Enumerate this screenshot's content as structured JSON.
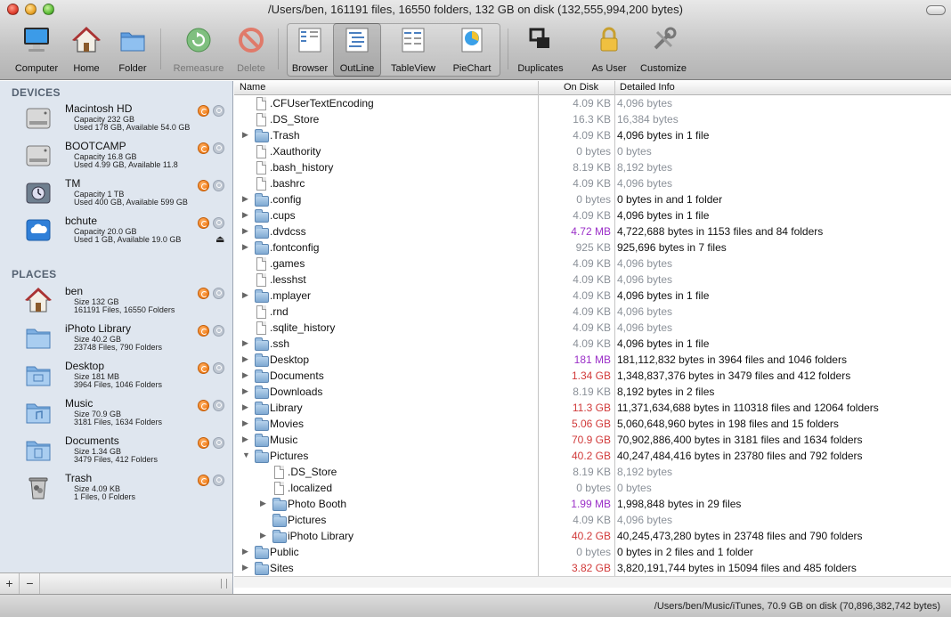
{
  "window": {
    "title": "/Users/ben, 161191 files, 16550 folders, 132 GB on disk (132,555,994,200 bytes)"
  },
  "toolbar": {
    "computer": "Computer",
    "home": "Home",
    "folder": "Folder",
    "remeasure": "Remeasure",
    "delete": "Delete",
    "browser": "Browser",
    "outline": "OutLine",
    "tableview": "TableView",
    "piechart": "PieChart",
    "duplicates": "Duplicates",
    "asuser": "As User",
    "customize": "Customize"
  },
  "sidebar": {
    "devices_header": "DEVICES",
    "places_header": "PLACES",
    "devices": [
      {
        "name": "Macintosh HD",
        "line1": "Capacity 232 GB",
        "line2": "Used 178 GB, Available 54.0 GB",
        "icon": "hard-drive-icon"
      },
      {
        "name": "BOOTCAMP",
        "line1": "Capacity 16.8 GB",
        "line2": "Used 4.99 GB, Available 11.8",
        "icon": "hard-drive-icon"
      },
      {
        "name": "TM",
        "line1": "Capacity 1 TB",
        "line2": "Used 400 GB, Available 599 GB",
        "icon": "time-machine-icon"
      },
      {
        "name": "bchute",
        "line1": "Capacity 20.0 GB",
        "line2": "Used 1 GB, Available 19.0 GB",
        "icon": "cloud-drive-icon"
      }
    ],
    "places": [
      {
        "name": "ben",
        "line1": "Size 132 GB",
        "line2": "161191 Files, 16550 Folders",
        "icon": "home-icon"
      },
      {
        "name": "iPhoto Library",
        "line1": "Size 40.2 GB",
        "line2": "23748 Files, 790 Folders",
        "icon": "folder-icon"
      },
      {
        "name": "Desktop",
        "line1": "Size 181 MB",
        "line2": "3964 Files, 1046 Folders",
        "icon": "desktop-folder-icon"
      },
      {
        "name": "Music",
        "line1": "Size 70.9 GB",
        "line2": "3181 Files, 1634 Folders",
        "icon": "music-folder-icon"
      },
      {
        "name": "Documents",
        "line1": "Size 1.34 GB",
        "line2": "3479 Files, 412 Folders",
        "icon": "documents-folder-icon"
      },
      {
        "name": "Trash",
        "line1": "Size 4.09 KB",
        "line2": "1 Files, 0 Folders",
        "icon": "trash-icon"
      }
    ],
    "add_label": "+",
    "remove_label": "−"
  },
  "table": {
    "headers": {
      "name": "Name",
      "size": "On Disk",
      "info": "Detailed Info"
    },
    "rows": [
      {
        "name": ".CFUserTextEncoding",
        "size": "4.09 KB",
        "info": "4,096 bytes",
        "kind": "file",
        "depth": 0,
        "size_color": "#8b9199",
        "gray": true
      },
      {
        "name": ".DS_Store",
        "size": "16.3 KB",
        "info": "16,384 bytes",
        "kind": "file",
        "depth": 0,
        "size_color": "#8b9199",
        "gray": true
      },
      {
        "name": ".Trash",
        "size": "4.09 KB",
        "info": "4,096 bytes in 1 file",
        "kind": "folder",
        "depth": 0,
        "size_color": "#8b9199",
        "gray": false
      },
      {
        "name": ".Xauthority",
        "size": "0 bytes",
        "info": "0 bytes",
        "kind": "file",
        "depth": 0,
        "size_color": "#8b9199",
        "gray": true
      },
      {
        "name": ".bash_history",
        "size": "8.19 KB",
        "info": "8,192 bytes",
        "kind": "file",
        "depth": 0,
        "size_color": "#8b9199",
        "gray": true
      },
      {
        "name": ".bashrc",
        "size": "4.09 KB",
        "info": "4,096 bytes",
        "kind": "file",
        "depth": 0,
        "size_color": "#8b9199",
        "gray": true
      },
      {
        "name": ".config",
        "size": "0 bytes",
        "info": "0 bytes in  and 1 folder",
        "kind": "folder",
        "depth": 0,
        "size_color": "#8b9199",
        "gray": false
      },
      {
        "name": ".cups",
        "size": "4.09 KB",
        "info": "4,096 bytes in 1 file",
        "kind": "folder",
        "depth": 0,
        "size_color": "#8b9199",
        "gray": false
      },
      {
        "name": ".dvdcss",
        "size": "4.72 MB",
        "info": "4,722,688 bytes in 1153 files and 84 folders",
        "kind": "folder",
        "depth": 0,
        "size_color": "#9b30c8",
        "gray": false
      },
      {
        "name": ".fontconfig",
        "size": "925 KB",
        "info": "925,696 bytes in 7 files",
        "kind": "folder",
        "depth": 0,
        "size_color": "#8b9199",
        "gray": false
      },
      {
        "name": ".games",
        "size": "4.09 KB",
        "info": "4,096 bytes",
        "kind": "file",
        "depth": 0,
        "size_color": "#8b9199",
        "gray": true
      },
      {
        "name": ".lesshst",
        "size": "4.09 KB",
        "info": "4,096 bytes",
        "kind": "file",
        "depth": 0,
        "size_color": "#8b9199",
        "gray": true
      },
      {
        "name": ".mplayer",
        "size": "4.09 KB",
        "info": "4,096 bytes in 1 file",
        "kind": "folder",
        "depth": 0,
        "size_color": "#8b9199",
        "gray": false
      },
      {
        "name": ".rnd",
        "size": "4.09 KB",
        "info": "4,096 bytes",
        "kind": "file",
        "depth": 0,
        "size_color": "#8b9199",
        "gray": true
      },
      {
        "name": ".sqlite_history",
        "size": "4.09 KB",
        "info": "4,096 bytes",
        "kind": "file",
        "depth": 0,
        "size_color": "#8b9199",
        "gray": true
      },
      {
        "name": ".ssh",
        "size": "4.09 KB",
        "info": "4,096 bytes in 1 file",
        "kind": "folder",
        "depth": 0,
        "size_color": "#8b9199",
        "gray": false
      },
      {
        "name": "Desktop",
        "size": "181 MB",
        "info": "181,112,832 bytes in 3964 files and 1046 folders",
        "kind": "folder",
        "depth": 0,
        "size_color": "#9b30c8",
        "gray": false
      },
      {
        "name": "Documents",
        "size": "1.34 GB",
        "info": "1,348,837,376 bytes in 3479 files and 412 folders",
        "kind": "folder",
        "depth": 0,
        "size_color": "#d13a3a",
        "gray": false
      },
      {
        "name": "Downloads",
        "size": "8.19 KB",
        "info": "8,192 bytes in 2 files",
        "kind": "folder",
        "depth": 0,
        "size_color": "#8b9199",
        "gray": false
      },
      {
        "name": "Library",
        "size": "11.3 GB",
        "info": "11,371,634,688 bytes in 110318 files and 12064 folders",
        "kind": "folder",
        "depth": 0,
        "size_color": "#d13a3a",
        "gray": false
      },
      {
        "name": "Movies",
        "size": "5.06 GB",
        "info": "5,060,648,960 bytes in 198 files and 15 folders",
        "kind": "folder",
        "depth": 0,
        "size_color": "#d13a3a",
        "gray": false
      },
      {
        "name": "Music",
        "size": "70.9 GB",
        "info": "70,902,886,400 bytes in 3181 files and 1634 folders",
        "kind": "folder",
        "depth": 0,
        "size_color": "#d13a3a",
        "gray": false
      },
      {
        "name": "Pictures",
        "size": "40.2 GB",
        "info": "40,247,484,416 bytes in 23780 files and 792 folders",
        "kind": "folder-open",
        "depth": 0,
        "size_color": "#d13a3a",
        "gray": false
      },
      {
        "name": ".DS_Store",
        "size": "8.19 KB",
        "info": "8,192 bytes",
        "kind": "file",
        "depth": 1,
        "size_color": "#8b9199",
        "gray": true
      },
      {
        "name": ".localized",
        "size": "0 bytes",
        "info": "0 bytes",
        "kind": "file",
        "depth": 1,
        "size_color": "#8b9199",
        "gray": true
      },
      {
        "name": "Photo Booth",
        "size": "1.99 MB",
        "info": "1,998,848 bytes in 29 files",
        "kind": "folder",
        "depth": 1,
        "size_color": "#9b30c8",
        "gray": false
      },
      {
        "name": "Pictures",
        "size": "4.09 KB",
        "info": "4,096 bytes",
        "kind": "alias",
        "depth": 1,
        "size_color": "#8b9199",
        "gray": true
      },
      {
        "name": "iPhoto Library",
        "size": "40.2 GB",
        "info": "40,245,473,280 bytes in 23748 files and 790 folders",
        "kind": "folder",
        "depth": 1,
        "size_color": "#d13a3a",
        "gray": false
      },
      {
        "name": "Public",
        "size": "0 bytes",
        "info": "0 bytes in 2 files and 1 folder",
        "kind": "folder",
        "depth": 0,
        "size_color": "#8b9199",
        "gray": false
      },
      {
        "name": "Sites",
        "size": "3.82 GB",
        "info": "3,820,191,744 bytes in 15094 files and 485 folders",
        "kind": "folder",
        "depth": 0,
        "size_color": "#d13a3a",
        "gray": false
      }
    ]
  },
  "status": {
    "text": "/Users/ben/Music/iTunes, 70.9 GB on disk (70,896,382,742 bytes)"
  }
}
